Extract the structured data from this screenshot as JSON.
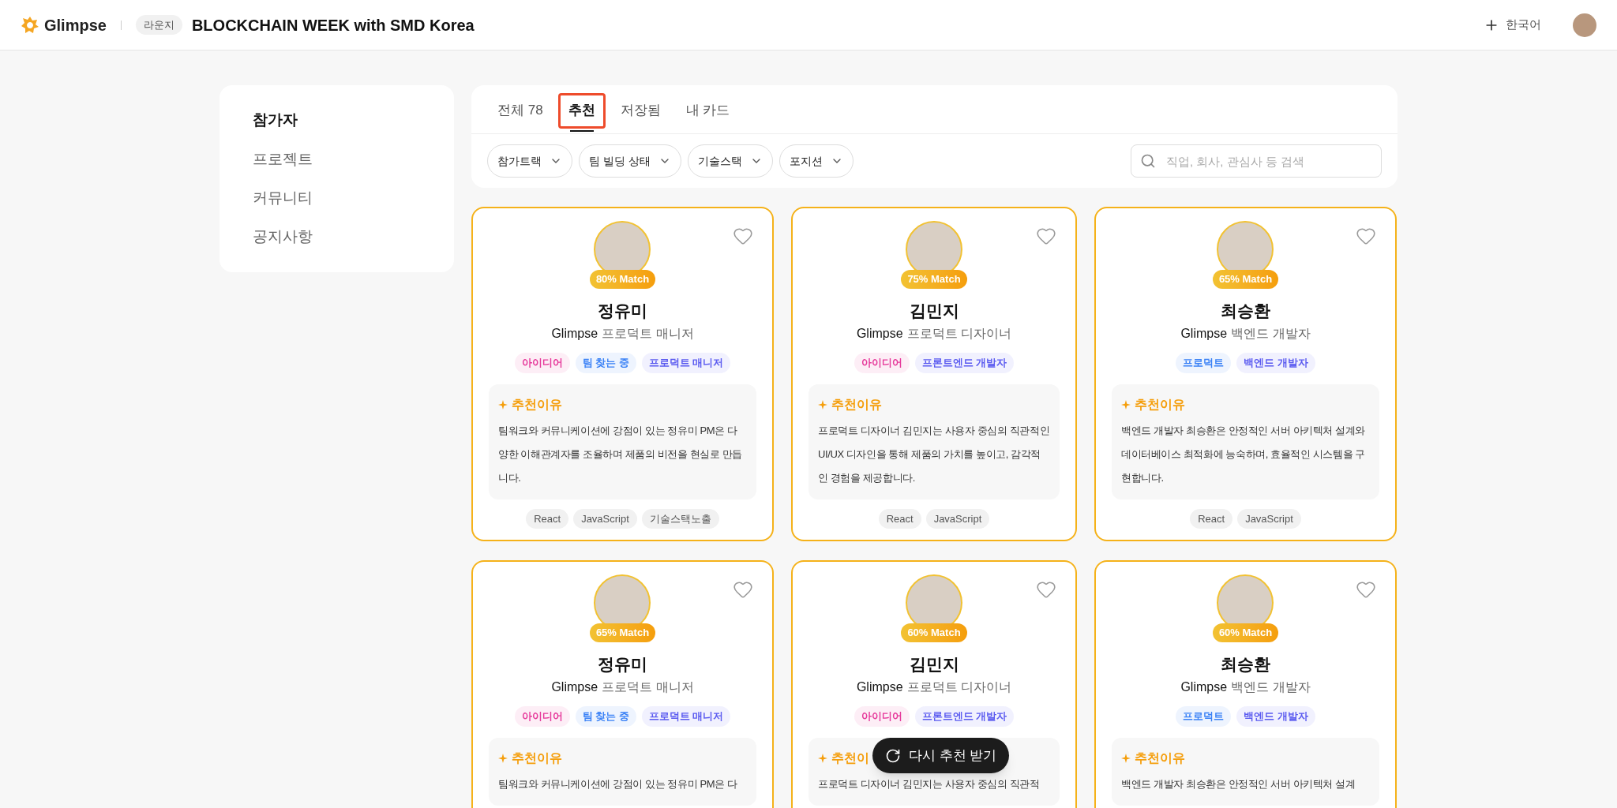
{
  "header": {
    "brand": "Glimpse",
    "badge": "라운지",
    "title": "BLOCKCHAIN WEEK with SMD Korea",
    "language": "한국어"
  },
  "sidebar": {
    "items": [
      {
        "label": "참가자",
        "selected": true
      },
      {
        "label": "프로젝트",
        "selected": false
      },
      {
        "label": "커뮤니티",
        "selected": false
      },
      {
        "label": "공지사항",
        "selected": false
      }
    ]
  },
  "tabs": [
    {
      "label": "전체 78",
      "selected": false
    },
    {
      "label": "추천",
      "selected": true
    },
    {
      "label": "저장됨",
      "selected": false
    },
    {
      "label": "내 카드",
      "selected": false
    }
  ],
  "filters": [
    "참가트랙",
    "팀 빌딩 상태",
    "기술스택",
    "포지션"
  ],
  "search": {
    "placeholder": "직업, 회사, 관심사 등 검색"
  },
  "cards": [
    {
      "match": "80% Match",
      "name": "정유미",
      "company": "Glimpse",
      "role": "프로덕트 매니저",
      "liked": false,
      "tags": [
        {
          "label": "아이디어",
          "color": "#e6399b"
        },
        {
          "label": "팀 찾는 중",
          "color": "#3b82f6"
        },
        {
          "label": "프로덕트 매니저",
          "color": "#5b5bf0"
        }
      ],
      "reason_title": "추천이유",
      "reason": "팀워크와 커뮤니케이션에 강점이 있는 정유미 PM은 다양한 이해관계자를 조율하며 제품의 비전을 현실로 만듭니다.",
      "skills": [
        "React",
        "JavaScript",
        "기술스택노출"
      ]
    },
    {
      "match": "75% Match",
      "name": "김민지",
      "company": "Glimpse",
      "role": "프로덕트 디자이너",
      "liked": false,
      "tags": [
        {
          "label": "아이디어",
          "color": "#e6399b"
        },
        {
          "label": "프론트엔드 개발자",
          "color": "#5b5bf0"
        }
      ],
      "reason_title": "추천이유",
      "reason": "프로덕트 디자이너 김민지는 사용자 중심의 직관적인 UI/UX 디자인을 통해 제품의 가치를 높이고, 감각적인 경험을 제공합니다.",
      "skills": [
        "React",
        "JavaScript"
      ]
    },
    {
      "match": "65% Match",
      "name": "최승환",
      "company": "Glimpse",
      "role": "백엔드 개발자",
      "liked": false,
      "tags": [
        {
          "label": "프로덕트",
          "color": "#3b82f6"
        },
        {
          "label": "백엔드 개발자",
          "color": "#5b5bf0"
        }
      ],
      "reason_title": "추천이유",
      "reason": "백엔드 개발자 최승환은 안정적인 서버 아키텍처 설계와 데이터베이스 최적화에 능숙하며, 효율적인 시스템을 구현합니다.",
      "skills": [
        "React",
        "JavaScript"
      ]
    },
    {
      "match": "65% Match",
      "name": "정유미",
      "company": "Glimpse",
      "role": "프로덕트 매니저",
      "liked": false,
      "tags": [
        {
          "label": "아이디어",
          "color": "#e6399b"
        },
        {
          "label": "팀 찾는 중",
          "color": "#3b82f6"
        },
        {
          "label": "프로덕트 매니저",
          "color": "#5b5bf0"
        }
      ],
      "reason_title": "추천이유",
      "reason": "팀워크와 커뮤니케이션에 강점이 있는 정유미 PM은 다"
    },
    {
      "match": "60% Match",
      "name": "김민지",
      "company": "Glimpse",
      "role": "프로덕트 디자이너",
      "liked": false,
      "tags": [
        {
          "label": "아이디어",
          "color": "#e6399b"
        },
        {
          "label": "프론트엔드 개발자",
          "color": "#5b5bf0"
        }
      ],
      "reason_title": "추천이",
      "reason": "프로덕트 디자이너 김민지는 사용자 중심의 직관적"
    },
    {
      "match": "60% Match",
      "name": "최승환",
      "company": "Glimpse",
      "role": "백엔드 개발자",
      "liked": false,
      "tags": [
        {
          "label": "프로덕트",
          "color": "#3b82f6"
        },
        {
          "label": "백엔드 개발자",
          "color": "#5b5bf0"
        }
      ],
      "reason_title": "추천이유",
      "reason": "백엔드 개발자 최승환은 안정적인 서버 아키텍처 설계"
    }
  ],
  "refresh_button": "다시 추천 받기"
}
